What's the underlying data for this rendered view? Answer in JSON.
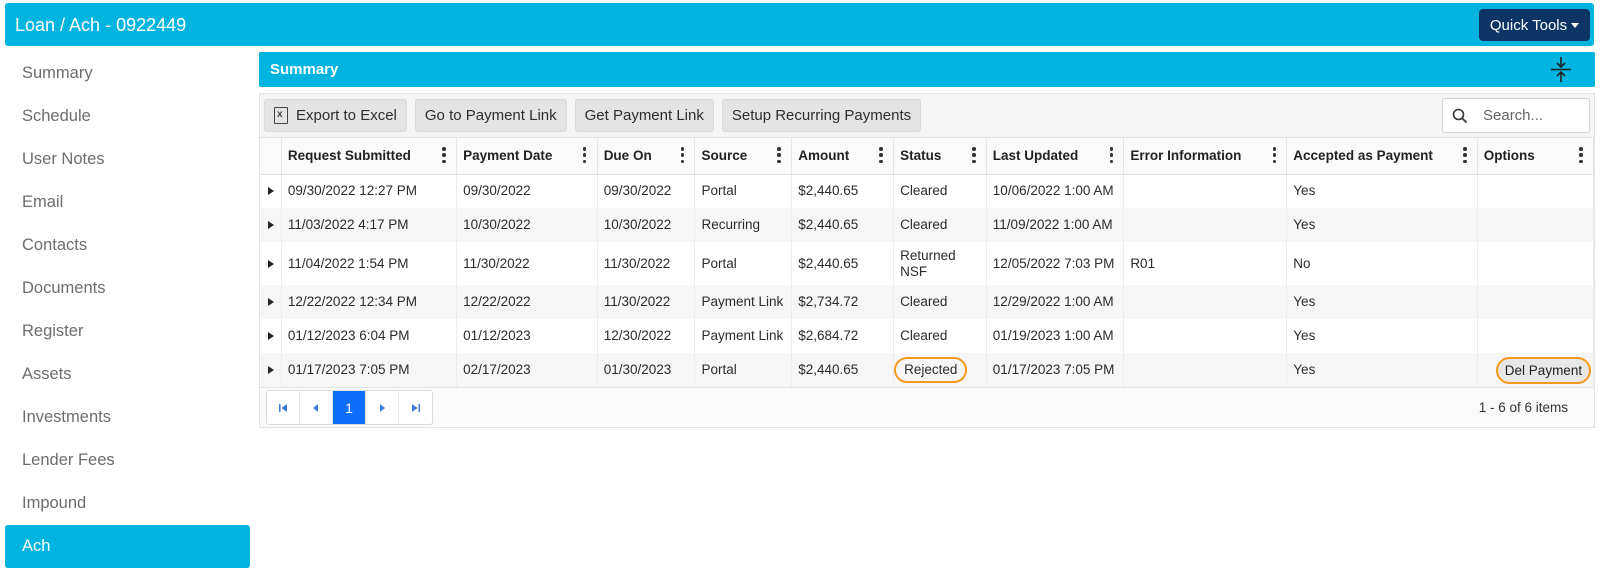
{
  "header": {
    "title": "Loan / Ach - 0922449",
    "quick_tools_label": "Quick Tools"
  },
  "sidebar": {
    "items": [
      {
        "label": "Summary"
      },
      {
        "label": "Schedule"
      },
      {
        "label": "User Notes"
      },
      {
        "label": "Email"
      },
      {
        "label": "Contacts"
      },
      {
        "label": "Documents"
      },
      {
        "label": "Register"
      },
      {
        "label": "Assets"
      },
      {
        "label": "Investments"
      },
      {
        "label": "Lender Fees"
      },
      {
        "label": "Impound"
      },
      {
        "label": "Ach"
      }
    ],
    "active": "Ach"
  },
  "panel": {
    "title": "Summary",
    "toolbar": {
      "export_label": "Export to Excel",
      "goto_payment_label": "Go to Payment Link",
      "get_payment_label": "Get Payment Link",
      "recurring_label": "Setup Recurring Payments",
      "search_placeholder": "Search..."
    },
    "columns": [
      "Request Submitted",
      "Payment Date",
      "Due On",
      "Source",
      "Amount",
      "Status",
      "Last Updated",
      "Error Information",
      "Accepted as Payment",
      "Options"
    ],
    "rows": [
      {
        "request_submitted": "09/30/2022 12:27 PM",
        "payment_date": "09/30/2022",
        "due_on": "09/30/2022",
        "source": "Portal",
        "amount": "$2,440.65",
        "status": "Cleared",
        "last_updated": "10/06/2022 1:00 AM",
        "error": "",
        "accepted": "Yes",
        "option": ""
      },
      {
        "request_submitted": "11/03/2022 4:17 PM",
        "payment_date": "10/30/2022",
        "due_on": "10/30/2022",
        "source": "Recurring",
        "amount": "$2,440.65",
        "status": "Cleared",
        "last_updated": "11/09/2022 1:00 AM",
        "error": "",
        "accepted": "Yes",
        "option": ""
      },
      {
        "request_submitted": "11/04/2022 1:54 PM",
        "payment_date": "11/30/2022",
        "due_on": "11/30/2022",
        "source": "Portal",
        "amount": "$2,440.65",
        "status": "Returned NSF",
        "last_updated": "12/05/2022 7:03 PM",
        "error": "R01",
        "accepted": "No",
        "option": ""
      },
      {
        "request_submitted": "12/22/2022 12:34 PM",
        "payment_date": "12/22/2022",
        "due_on": "11/30/2022",
        "source": "Payment Link",
        "amount": "$2,734.72",
        "status": "Cleared",
        "last_updated": "12/29/2022 1:00 AM",
        "error": "",
        "accepted": "Yes",
        "option": ""
      },
      {
        "request_submitted": "01/12/2023 6:04 PM",
        "payment_date": "01/12/2023",
        "due_on": "12/30/2022",
        "source": "Payment Link",
        "amount": "$2,684.72",
        "status": "Cleared",
        "last_updated": "01/19/2023 1:00 AM",
        "error": "",
        "accepted": "Yes",
        "option": ""
      },
      {
        "request_submitted": "01/17/2023 7:05 PM",
        "payment_date": "02/17/2023",
        "due_on": "01/30/2023",
        "source": "Portal",
        "amount": "$2,440.65",
        "status": "Rejected",
        "last_updated": "01/17/2023 7:05 PM",
        "error": "",
        "accepted": "Yes",
        "option": "Del Payment"
      }
    ],
    "pager": {
      "current_page": "1",
      "info": "1 - 6 of 6 items"
    }
  },
  "colors": {
    "accent": "#00b4e0",
    "quick_tools_bg": "#0c3566",
    "page_active": "#0d6efd",
    "annotation": "#f59a1e"
  }
}
